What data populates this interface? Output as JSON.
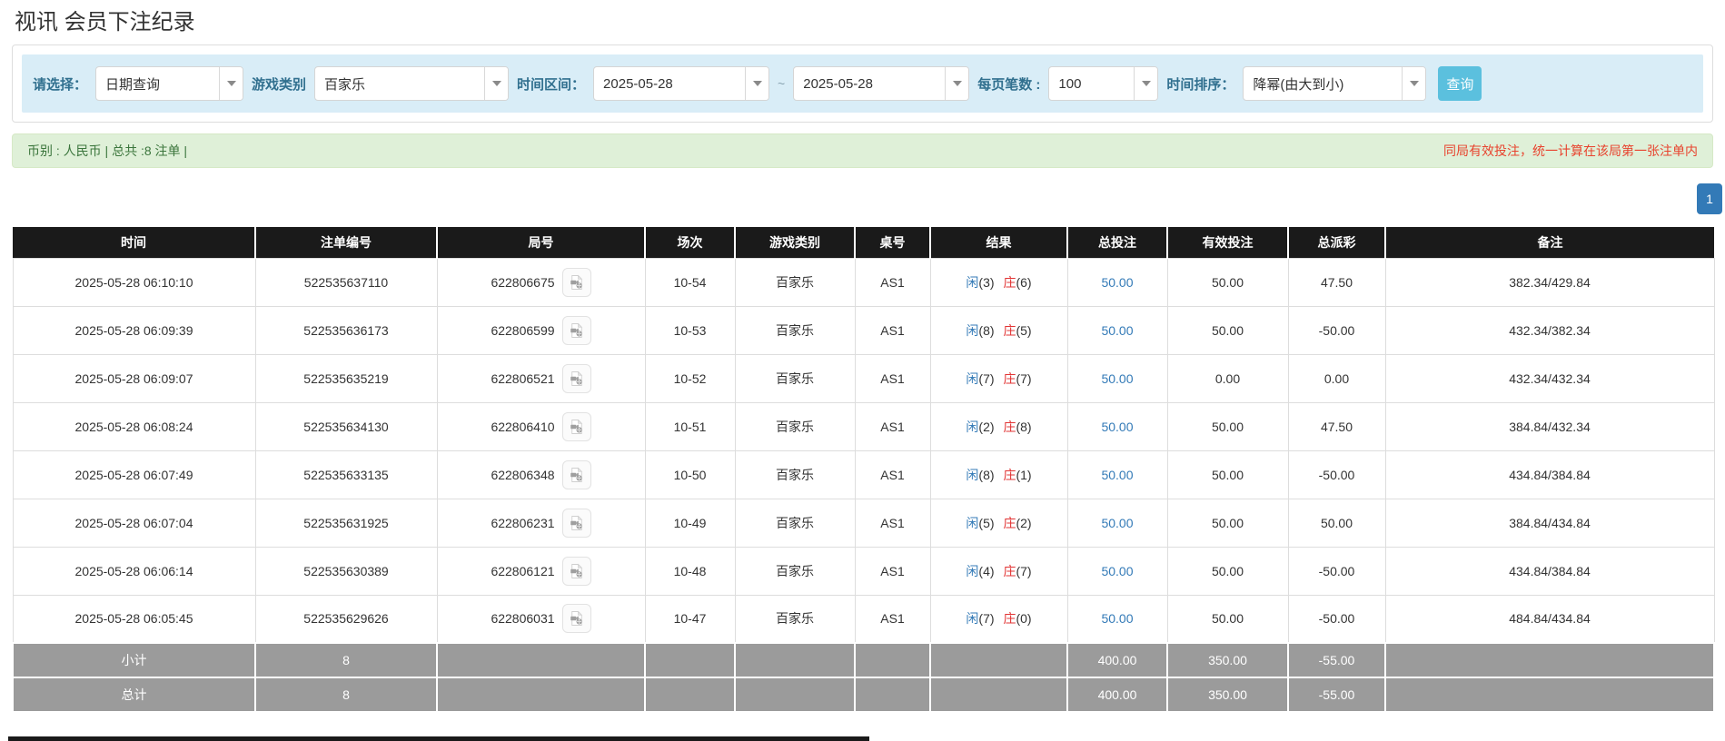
{
  "page": {
    "title": "视讯 会员下注纪录"
  },
  "filters": {
    "select": {
      "label": "请选择：",
      "value": "日期查询"
    },
    "game_type": {
      "label": "游戏类别",
      "value": "百家乐"
    },
    "date_range": {
      "label": "时间区间：",
      "from": "2025-05-28",
      "separator": "~",
      "to": "2025-05-28"
    },
    "page_size": {
      "label": "每页笔数 :",
      "value": "100"
    },
    "sort": {
      "label": "时间排序：",
      "value": "降幂(由大到小)"
    },
    "search_button_label": "查询"
  },
  "summary_bar": {
    "left_text": "币别 : 人民币 | 总共 :8 注单 |",
    "right_note": "同局有效投注，统一计算在该局第一张注单内"
  },
  "pagination": {
    "current_page": "1"
  },
  "table": {
    "headers": {
      "time": "时间",
      "bet_id": "注单编号",
      "round": "局号",
      "session": "场次",
      "game": "游戏类别",
      "table_no": "桌号",
      "result": "结果",
      "total_bet": "总投注",
      "valid_bet": "有效投注",
      "payout": "总派彩",
      "remark": "备注"
    },
    "rows": [
      {
        "time": "2025-05-28 06:10:10",
        "bet_id": "522535637110",
        "round_id": "622806675",
        "session": "10-54",
        "game": "百家乐",
        "table_no": "AS1",
        "result_player_label": "闲",
        "result_player_value": "(3)",
        "result_banker_label": "庄",
        "result_banker_value": "(6)",
        "total_bet": "50.00",
        "valid_bet": "50.00",
        "payout": "47.50",
        "remark": "382.34/429.84"
      },
      {
        "time": "2025-05-28 06:09:39",
        "bet_id": "522535636173",
        "round_id": "622806599",
        "session": "10-53",
        "game": "百家乐",
        "table_no": "AS1",
        "result_player_label": "闲",
        "result_player_value": "(8)",
        "result_banker_label": "庄",
        "result_banker_value": "(5)",
        "total_bet": "50.00",
        "valid_bet": "50.00",
        "payout": "-50.00",
        "remark": "432.34/382.34"
      },
      {
        "time": "2025-05-28 06:09:07",
        "bet_id": "522535635219",
        "round_id": "622806521",
        "session": "10-52",
        "game": "百家乐",
        "table_no": "AS1",
        "result_player_label": "闲",
        "result_player_value": "(7)",
        "result_banker_label": "庄",
        "result_banker_value": "(7)",
        "total_bet": "50.00",
        "valid_bet": "0.00",
        "payout": "0.00",
        "remark": "432.34/432.34"
      },
      {
        "time": "2025-05-28 06:08:24",
        "bet_id": "522535634130",
        "round_id": "622806410",
        "session": "10-51",
        "game": "百家乐",
        "table_no": "AS1",
        "result_player_label": "闲",
        "result_player_value": "(2)",
        "result_banker_label": "庄",
        "result_banker_value": "(8)",
        "total_bet": "50.00",
        "valid_bet": "50.00",
        "payout": "47.50",
        "remark": "384.84/432.34"
      },
      {
        "time": "2025-05-28 06:07:49",
        "bet_id": "522535633135",
        "round_id": "622806348",
        "session": "10-50",
        "game": "百家乐",
        "table_no": "AS1",
        "result_player_label": "闲",
        "result_player_value": "(8)",
        "result_banker_label": "庄",
        "result_banker_value": "(1)",
        "total_bet": "50.00",
        "valid_bet": "50.00",
        "payout": "-50.00",
        "remark": "434.84/384.84"
      },
      {
        "time": "2025-05-28 06:07:04",
        "bet_id": "522535631925",
        "round_id": "622806231",
        "session": "10-49",
        "game": "百家乐",
        "table_no": "AS1",
        "result_player_label": "闲",
        "result_player_value": "(5)",
        "result_banker_label": "庄",
        "result_banker_value": "(2)",
        "total_bet": "50.00",
        "valid_bet": "50.00",
        "payout": "50.00",
        "remark": "384.84/434.84"
      },
      {
        "time": "2025-05-28 06:06:14",
        "bet_id": "522535630389",
        "round_id": "622806121",
        "session": "10-48",
        "game": "百家乐",
        "table_no": "AS1",
        "result_player_label": "闲",
        "result_player_value": "(4)",
        "result_banker_label": "庄",
        "result_banker_value": "(7)",
        "total_bet": "50.00",
        "valid_bet": "50.00",
        "payout": "-50.00",
        "remark": "434.84/384.84"
      },
      {
        "time": "2025-05-28 06:05:45",
        "bet_id": "522535629626",
        "round_id": "622806031",
        "session": "10-47",
        "game": "百家乐",
        "table_no": "AS1",
        "result_player_label": "闲",
        "result_player_value": "(7)",
        "result_banker_label": "庄",
        "result_banker_value": "(0)",
        "total_bet": "50.00",
        "valid_bet": "50.00",
        "payout": "-50.00",
        "remark": "484.84/434.84"
      }
    ],
    "subtotal": {
      "label": "小计",
      "count": "8",
      "total_bet": "400.00",
      "valid_bet": "350.00",
      "payout": "-55.00"
    },
    "total": {
      "label": "总计",
      "count": "8",
      "total_bet": "400.00",
      "valid_bet": "350.00",
      "payout": "-55.00"
    }
  },
  "icons": {
    "dropdown_arrow": "chevron-down-icon",
    "round_video": "video-camera-icon"
  },
  "colors": {
    "filter_bar_bg": "#d9edf7",
    "filter_label": "#31708f",
    "search_button": "#5bc0de",
    "summary_bg": "#dff0d8",
    "summary_text": "#3c763d",
    "warning_red": "#e8432e",
    "link_blue": "#337ab7",
    "player_blue": "#337ab7",
    "banker_red": "#e23434",
    "negative_red": "#ee0000",
    "table_header_bg": "#1a1a1a",
    "table_footer_bg": "#9b9b9b",
    "pagination_active": "#337ab7"
  }
}
